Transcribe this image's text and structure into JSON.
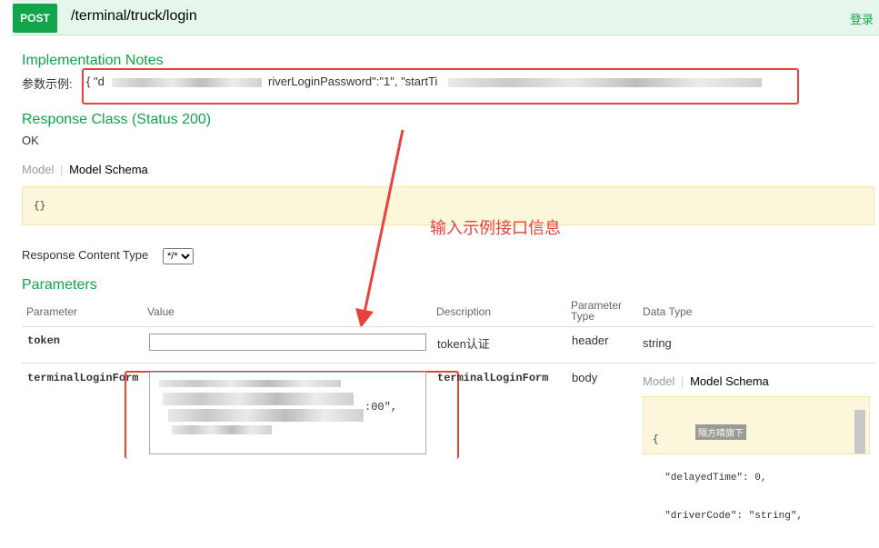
{
  "operation": {
    "method": "POST",
    "path": "/terminal/truck/login",
    "login_link": "登录"
  },
  "implementation_notes": {
    "heading": "Implementation Notes",
    "label": "参数示例:",
    "example_visible": [
      "{ \"d",
      "riverLoginPassword\":\"1\", \"startTi"
    ]
  },
  "response_class": {
    "heading": "Response Class (Status 200)",
    "status": "OK"
  },
  "model_tabs": {
    "model": "Model",
    "schema": "Model Schema"
  },
  "response_schema": "{}",
  "annotation": "输入示例接口信息",
  "response_content_type": {
    "label": "Response Content Type",
    "selected": "*/*"
  },
  "parameters": {
    "heading": "Parameters",
    "columns": [
      "Parameter",
      "Value",
      "Description",
      "Parameter Type",
      "Data Type"
    ],
    "rows": [
      {
        "name": "token",
        "value": "",
        "description": "token认证",
        "type": "header",
        "data_type": "string"
      },
      {
        "name": "terminalLoginForm",
        "value_visible": ":00\",",
        "description": "terminalLoginForm",
        "type": "body",
        "schema_lines": [
          "{",
          "  \"delayedTime\": 0,",
          "  \"driverCode\": \"string\","
        ]
      }
    ]
  },
  "watermark": "隔方晴旗下"
}
